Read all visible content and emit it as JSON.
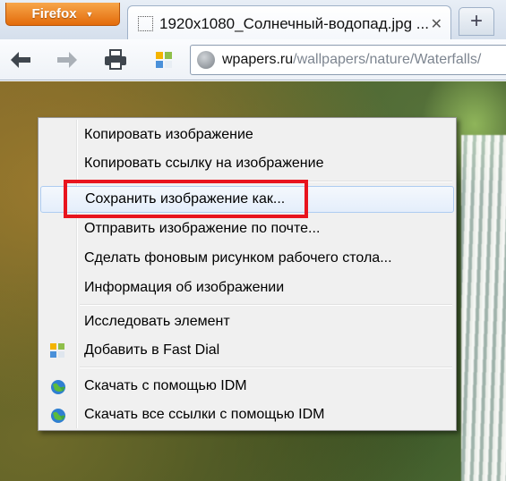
{
  "browser": {
    "menu_button_label": "Firefox",
    "menu_button_arrow": "▼",
    "tab_title": "1920x1080_Солнечный-водопад.jpg ...",
    "tab_close_glyph": "✕",
    "new_tab_glyph": "+",
    "url_domain": "wpapers.ru",
    "url_path": "/wallpapers/nature/Waterfalls/",
    "icons": {
      "back": "back-arrow-icon",
      "forward": "forward-arrow-icon",
      "print": "printer-icon",
      "fast_dial": "fast-dial-icon",
      "site": "globe-icon"
    }
  },
  "context_menu": {
    "items": [
      {
        "label": "Копировать изображение"
      },
      {
        "label": "Копировать ссылку на изображение"
      },
      {
        "label": "Сохранить изображение как..."
      },
      {
        "label": "Отправить изображение по почте..."
      },
      {
        "label": "Сделать фоновым рисунком рабочего стола..."
      },
      {
        "label": "Информация об изображении"
      },
      {
        "label": "Исследовать элемент"
      },
      {
        "label": "Добавить в Fast Dial",
        "icon": "fast-dial-icon"
      },
      {
        "label": "Скачать с помощью IDM",
        "icon": "idm-globe-icon"
      },
      {
        "label": "Скачать все ссылки с помощью IDM",
        "icon": "idm-globe-icon"
      }
    ],
    "highlighted_item": "Сохранить изображение как...",
    "highlight_color": "#e8141e"
  }
}
